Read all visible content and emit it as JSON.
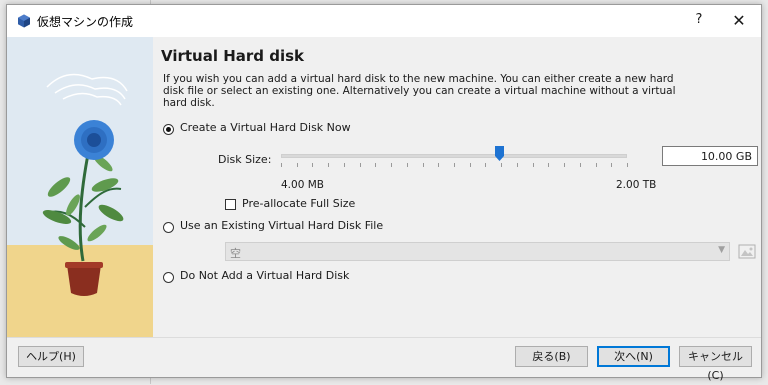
{
  "window": {
    "title": "仮想マシンの作成",
    "help_glyph": "?",
    "close_glyph": "✕"
  },
  "page": {
    "heading": "Virtual Hard disk",
    "description": "If you wish you can add a virtual hard disk to the new machine. You can either create a new hard disk file or select an existing one. Alternatively you can create a virtual machine without a virtual hard disk."
  },
  "options": {
    "create_new": {
      "label": "Create a Virtual Hard Disk Now",
      "selected": true
    },
    "use_existing": {
      "label": "Use an Existing Virtual Hard Disk File",
      "selected": false
    },
    "no_disk": {
      "label": "Do Not Add a Virtual Hard Disk",
      "selected": false
    }
  },
  "disk_size": {
    "label": "Disk Size:",
    "value": "10.00 GB",
    "min_label": "4.00 MB",
    "max_label": "2.00 TB",
    "slider_fraction": 0.63
  },
  "preallocate": {
    "label": "Pre-allocate Full Size",
    "checked": false
  },
  "existing_file": {
    "selected": "空"
  },
  "buttons": {
    "help": "ヘルプ(H)",
    "back": "戻る(B)",
    "next": "次へ(N)",
    "cancel": "キャンセル(C)"
  },
  "colors": {
    "accent": "#0078d7",
    "slider_thumb": "#1e73d2",
    "flower": "#3b82d6",
    "pot": "#8a2e1f",
    "table": "#f0d58c"
  }
}
